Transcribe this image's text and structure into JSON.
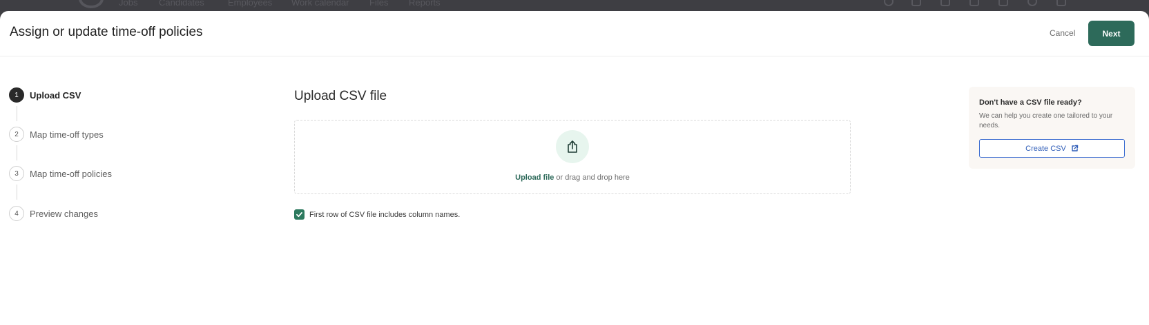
{
  "background_nav": {
    "items": [
      "Jobs",
      "Candidates",
      "Employees",
      "Work calendar",
      "Files",
      "Reports"
    ]
  },
  "modal": {
    "title": "Assign or update time-off policies",
    "cancel_label": "Cancel",
    "next_label": "Next"
  },
  "steps": [
    {
      "number": "1",
      "label": "Upload CSV",
      "active": true
    },
    {
      "number": "2",
      "label": "Map time-off types",
      "active": false
    },
    {
      "number": "3",
      "label": "Map time-off policies",
      "active": false
    },
    {
      "number": "4",
      "label": "Preview changes",
      "active": false
    }
  ],
  "main": {
    "section_title": "Upload CSV file",
    "dropzone": {
      "icon": "upload-icon",
      "upload_link": "Upload file",
      "drop_text": " or drag and drop here"
    },
    "checkbox": {
      "checked": true,
      "label": "First row of CSV file includes column names."
    }
  },
  "side_card": {
    "title": "Don't have a CSV file ready?",
    "description": "We can help you create one tailored to your needs.",
    "button_label": "Create CSV",
    "button_icon": "external-link-icon"
  },
  "colors": {
    "primary": "#2d6a5a",
    "link_blue": "#2f5db8",
    "upload_icon_bg": "#e7f5ee"
  }
}
